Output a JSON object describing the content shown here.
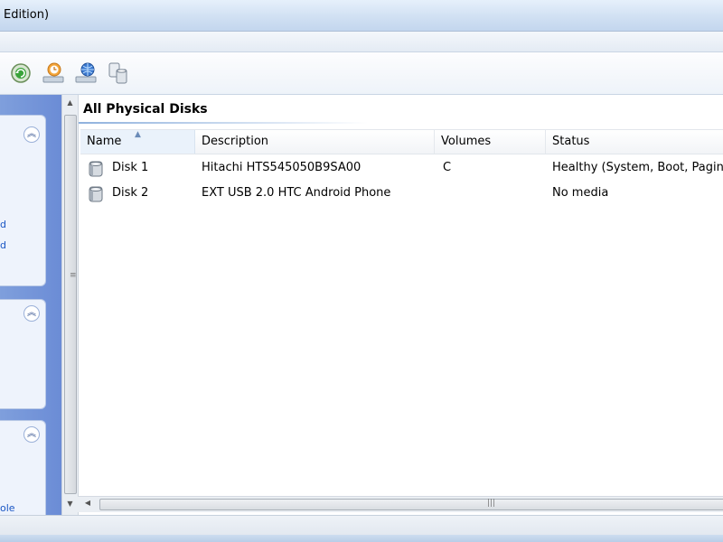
{
  "window": {
    "title": "Edition)"
  },
  "toolbar": {
    "buttons": [
      {
        "icon": "refresh-disk-icon"
      },
      {
        "icon": "disk-properties-icon"
      },
      {
        "icon": "disk-network-icon"
      },
      {
        "icon": "copy-disk-icon"
      }
    ]
  },
  "sidebar": {
    "links": [
      "d",
      "d",
      "ole"
    ]
  },
  "main": {
    "heading": "All Physical Disks",
    "columns": [
      "Name",
      "Description",
      "Volumes",
      "Status"
    ],
    "rows": [
      {
        "name": "Disk 1",
        "description": "Hitachi HTS545050B9SA00",
        "volumes": "C",
        "status": "Healthy (System, Boot, Paging)"
      },
      {
        "name": "Disk 2",
        "description": "EXT USB 2.0 HTC Android Phone",
        "volumes": "",
        "status": "No media"
      }
    ]
  }
}
